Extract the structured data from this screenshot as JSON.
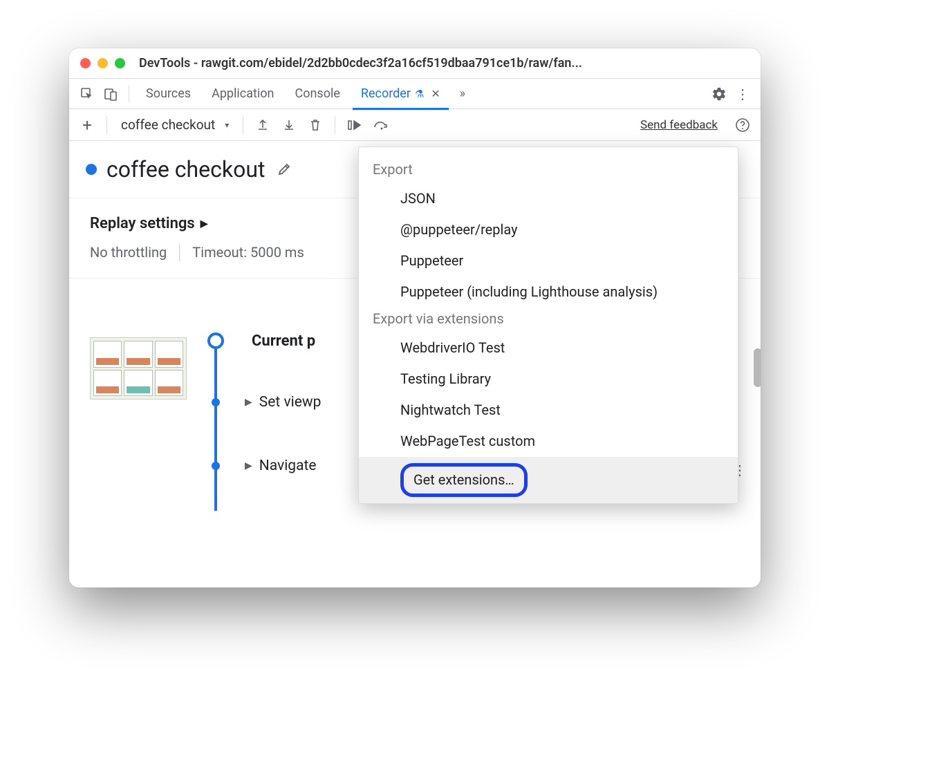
{
  "titlebar": {
    "title": "DevTools - rawgit.com/ebidel/2d2bb0cdec3f2a16cf519dbaa791ce1b/raw/fan..."
  },
  "tabs": {
    "items": [
      "Sources",
      "Application",
      "Console",
      "Recorder"
    ],
    "active_index": 3
  },
  "toolbar": {
    "recording_select": "coffee checkout",
    "feedback": "Send feedback"
  },
  "recording": {
    "title": "coffee checkout"
  },
  "replay": {
    "heading": "Replay settings",
    "throttling": "No throttling",
    "timeout": "Timeout: 5000 ms"
  },
  "steps": {
    "current": "Current p",
    "s2": "Set viewp",
    "s3": "Navigate"
  },
  "popup": {
    "group1_label": "Export",
    "group1": [
      "JSON",
      "@puppeteer/replay",
      "Puppeteer",
      "Puppeteer (including Lighthouse analysis)"
    ],
    "group2_label": "Export via extensions",
    "group2": [
      "WebdriverIO Test",
      "Testing Library",
      "Nightwatch Test",
      "WebPageTest custom"
    ],
    "get_ext": "Get extensions…"
  }
}
